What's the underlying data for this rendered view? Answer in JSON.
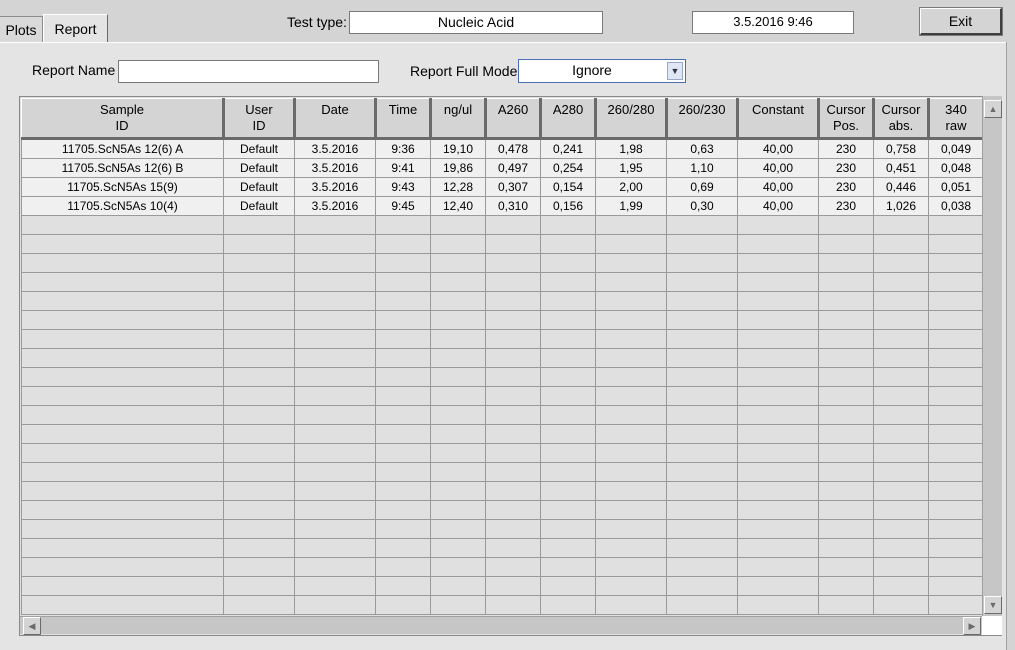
{
  "tabs": [
    {
      "label": "Plots"
    },
    {
      "label": "Report"
    }
  ],
  "header": {
    "test_type_label": "Test type:",
    "test_type_value": "Nucleic Acid",
    "datetime_value": "3.5.2016  9:46",
    "exit_label": "Exit"
  },
  "report": {
    "name_label": "Report Name",
    "name_value": "",
    "full_mode_label": "Report Full Mode",
    "full_mode_value": "Ignore"
  },
  "grid": {
    "columns": [
      {
        "line1": "Sample",
        "line2": "ID"
      },
      {
        "line1": "User",
        "line2": "ID"
      },
      {
        "line1": "Date",
        "line2": ""
      },
      {
        "line1": "Time",
        "line2": ""
      },
      {
        "line1": "ng/ul",
        "line2": ""
      },
      {
        "line1": "A260",
        "line2": ""
      },
      {
        "line1": "A280",
        "line2": ""
      },
      {
        "line1": "260/280",
        "line2": ""
      },
      {
        "line1": "260/230",
        "line2": ""
      },
      {
        "line1": "Constant",
        "line2": ""
      },
      {
        "line1": "Cursor",
        "line2": "Pos."
      },
      {
        "line1": "Cursor",
        "line2": "abs."
      },
      {
        "line1": "340",
        "line2": "raw"
      }
    ],
    "rows": [
      [
        "11705.ScN5As 12(6) A",
        "Default",
        "3.5.2016",
        "9:36",
        "19,10",
        "0,478",
        "0,241",
        "1,98",
        "0,63",
        "40,00",
        "230",
        "0,758",
        "0,049"
      ],
      [
        "11705.ScN5As 12(6) B",
        "Default",
        "3.5.2016",
        "9:41",
        "19,86",
        "0,497",
        "0,254",
        "1,95",
        "1,10",
        "40,00",
        "230",
        "0,451",
        "0,048"
      ],
      [
        "11705.ScN5As 15(9)",
        "Default",
        "3.5.2016",
        "9:43",
        "12,28",
        "0,307",
        "0,154",
        "2,00",
        "0,69",
        "40,00",
        "230",
        "0,446",
        "0,051"
      ],
      [
        "11705.ScN5As 10(4)",
        "Default",
        "3.5.2016",
        "9:45",
        "12,40",
        "0,310",
        "0,156",
        "1,99",
        "0,30",
        "40,00",
        "230",
        "1,026",
        "0,038"
      ]
    ]
  }
}
